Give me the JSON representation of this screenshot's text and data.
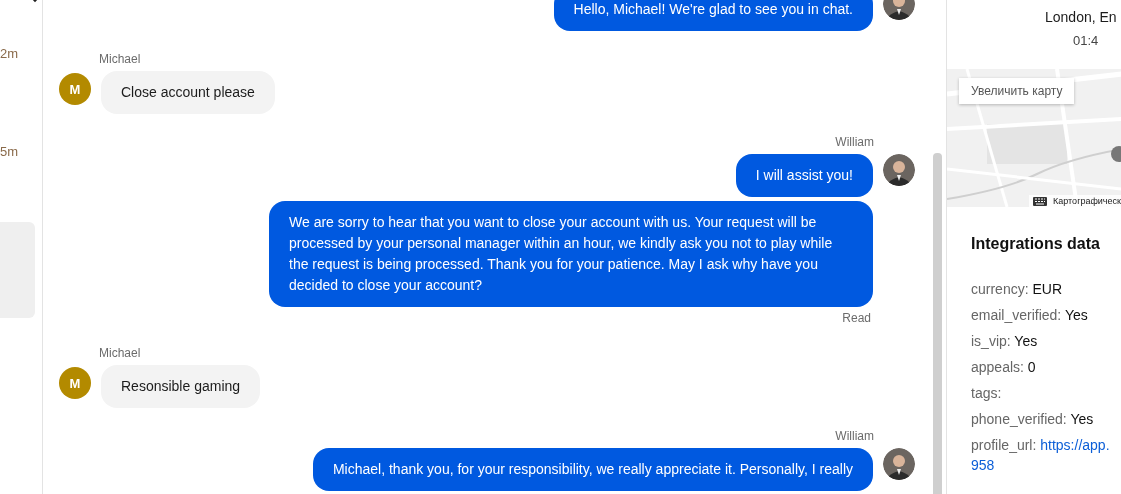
{
  "left_strip": {
    "times": [
      "2m",
      "5m"
    ]
  },
  "messages": [
    {
      "kind": "outgoing",
      "texts": [
        "Hello, Michael! We're glad to see you in chat."
      ]
    },
    {
      "kind": "incoming",
      "author": "Michael",
      "avatar_initial": "M",
      "texts": [
        "Close account please"
      ]
    },
    {
      "kind": "outgoing",
      "author": "William",
      "texts": [
        "I will assist you!",
        "We are sorry to hear that you want to close your account with us. Your request will be processed by your personal manager within an hour, we kindly ask you not to play while the request is being processed. Thank you for your patience. May I ask why have you decided to close your account?"
      ],
      "status": "Read"
    },
    {
      "kind": "incoming",
      "author": "Michael",
      "avatar_initial": "M",
      "texts": [
        "Resonsible gaming"
      ]
    },
    {
      "kind": "outgoing",
      "author": "William",
      "texts": [
        "Michael, thank you, for your responsibility, we really appreciate it. Personally, I really"
      ]
    }
  ],
  "side_panel": {
    "location": "London, En",
    "time": "01:4",
    "map": {
      "kind": "picture",
      "enlarge_button": "Увеличить карту",
      "attribution": "Картографическ"
    },
    "integrations": {
      "title": "Integrations data",
      "fields": [
        {
          "key": "currency:",
          "value": "EUR",
          "kind": "text"
        },
        {
          "key": "email_verified:",
          "value": "Yes",
          "kind": "text"
        },
        {
          "key": "is_vip:",
          "value": "Yes",
          "kind": "text"
        },
        {
          "key": "appeals:",
          "value": "0",
          "kind": "text"
        },
        {
          "key": "tags:",
          "kind": "text"
        },
        {
          "key": "phone_verified:",
          "value": "Yes",
          "kind": "text"
        },
        {
          "key": "profile_url:",
          "value_lines": [
            "https://app.",
            "958"
          ],
          "kind": "link"
        }
      ]
    }
  }
}
